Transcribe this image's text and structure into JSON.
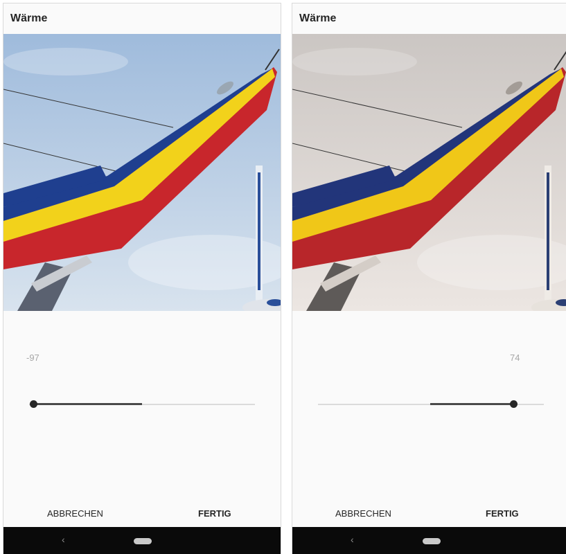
{
  "screens": [
    {
      "title": "Wärme",
      "value": "-97",
      "slider": {
        "value": -97,
        "min": -100,
        "max": 100
      },
      "cancel_label": "ABBRECHEN",
      "done_label": "FERTIG",
      "back_icon": "chevron-left-icon",
      "home_icon": "home-pill-icon",
      "photo_tone": "cool"
    },
    {
      "title": "Wärme",
      "value": "74",
      "slider": {
        "value": 74,
        "min": -100,
        "max": 100
      },
      "cancel_label": "ABBRECHEN",
      "done_label": "FERTIG",
      "back_icon": "chevron-left-icon",
      "home_icon": "home-pill-icon",
      "photo_tone": "warm"
    }
  ],
  "colors": {
    "sky_cool_top": "#9fbbdc",
    "sky_cool_bottom": "#d8e3ee",
    "sky_warm_top": "#cbc6c3",
    "sky_warm_bottom": "#ece6e2",
    "jet_blue": "#1f3f8f",
    "jet_yellow": "#f2d21b",
    "jet_red": "#c8262c"
  }
}
